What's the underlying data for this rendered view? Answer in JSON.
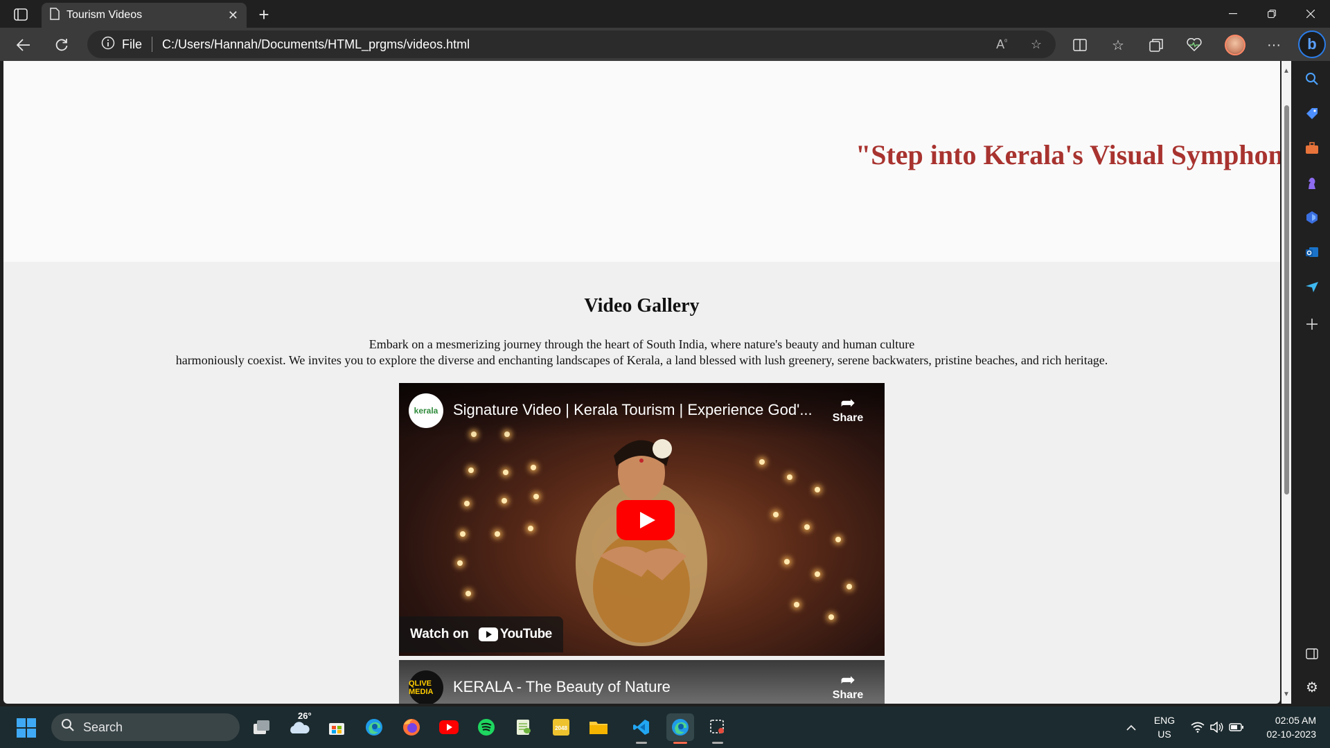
{
  "browser": {
    "tab_title": "Tourism Videos",
    "tab_close": "✕",
    "new_tab": "+",
    "scheme_label": "File",
    "url": "C:/Users/Hannah/Documents/HTML_prgms/videos.html",
    "more_label": "···"
  },
  "page": {
    "hero_text": "\"Step into Kerala's Visual Symphony",
    "gallery_title": "Video Gallery",
    "description_line1": "Embark on a mesmerizing journey through the heart of South India, where nature's beauty and human culture",
    "description_line2": "harmoniously coexist. We invites you to explore the diverse and enchanting landscapes of Kerala, a land blessed with lush greenery, serene backwaters, pristine beaches, and rich heritage.",
    "videos": [
      {
        "title": "Signature Video | Kerala Tourism | Experience God'...",
        "channel_logo_text": "kerala",
        "share_label": "Share",
        "watch_on_label": "Watch on",
        "youtube_label": "YouTube"
      },
      {
        "title": "KERALA - The Beauty of Nature",
        "channel_logo_text": "QLIVE MEDIA",
        "share_label": "Share"
      }
    ]
  },
  "taskbar": {
    "search_placeholder": "Search",
    "weather_temp": "26°",
    "lang_line1": "ENG",
    "lang_line2": "US",
    "time": "02:05 AM",
    "date": "02-10-2023"
  },
  "colors": {
    "hero_text": "#a8332f",
    "youtube_red": "#ff0000",
    "taskbar_bg": "#1c2b2f",
    "browser_chrome": "#202020"
  }
}
